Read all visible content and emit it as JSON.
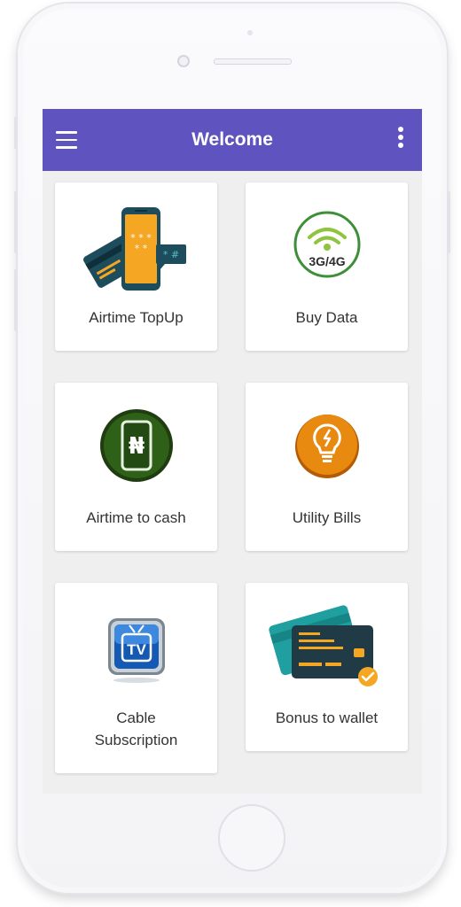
{
  "appbar": {
    "title": "Welcome"
  },
  "services": [
    {
      "label": "Airtime TopUp",
      "icon": "airtime-topup-icon"
    },
    {
      "label": "Buy Data",
      "icon": "data-3g4g-icon",
      "icon_text": "3G/4G"
    },
    {
      "label": "Airtime to cash",
      "icon": "naira-phone-icon",
      "icon_text": "₦"
    },
    {
      "label": "Utility Bills",
      "icon": "lightbulb-icon"
    },
    {
      "label": "Cable\nSubscription",
      "icon": "tv-icon",
      "icon_text": "TV"
    },
    {
      "label": "Bonus to wallet",
      "icon": "wallet-cards-icon"
    }
  ],
  "colors": {
    "appbar": "#5f53c0",
    "screen_bg": "#efefef",
    "card_bg": "#ffffff"
  }
}
